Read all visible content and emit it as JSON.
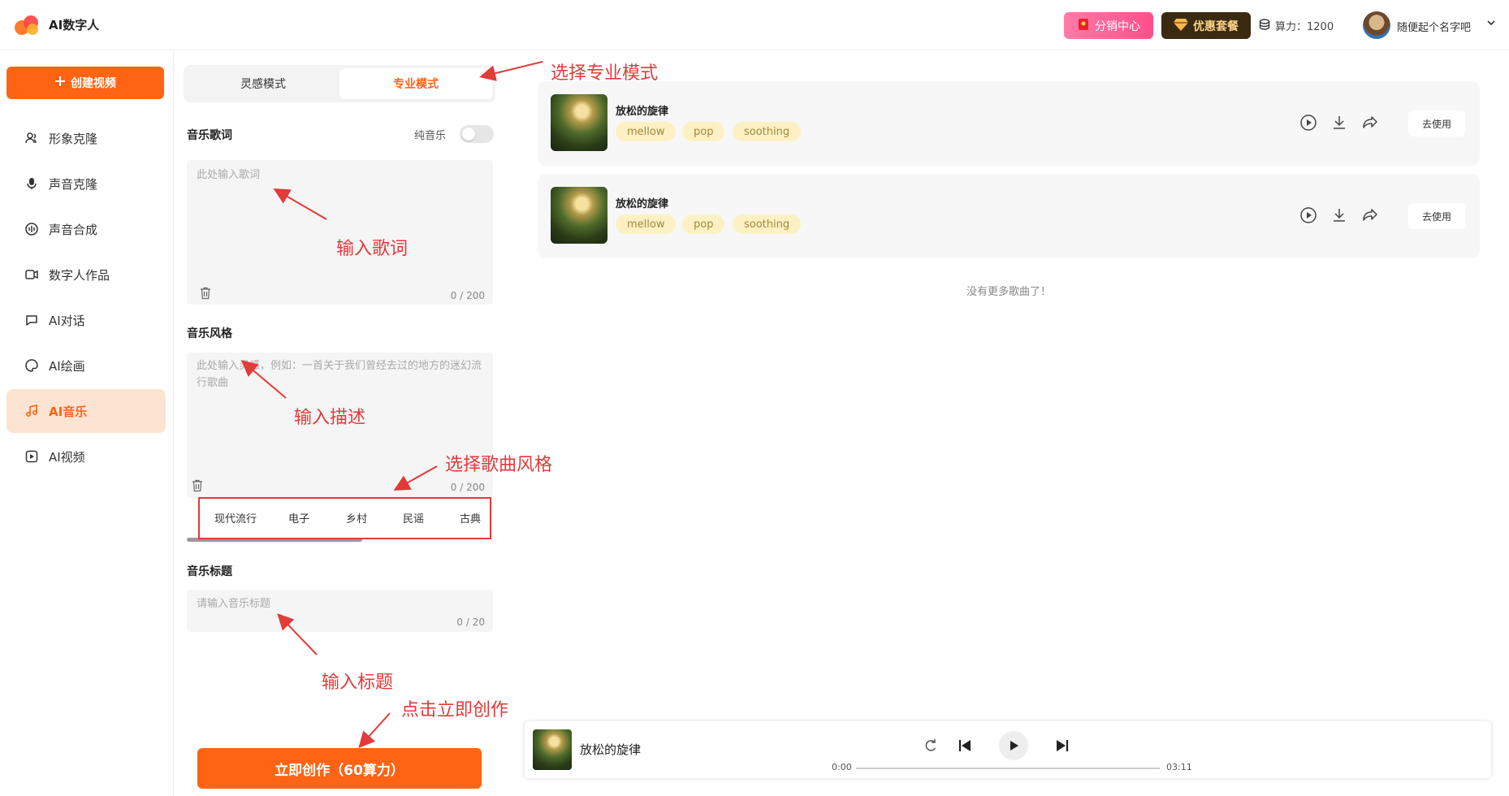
{
  "header": {
    "app_name": "AI数字人",
    "distribution_label": "分销中心",
    "package_label": "优惠套餐",
    "power_label": "算力：1200",
    "username": "随便起个名字吧"
  },
  "sidebar": {
    "create_label": "创建视频",
    "items": [
      {
        "label": "形象克隆",
        "icon": "user-clone-icon"
      },
      {
        "label": "声音克隆",
        "icon": "microphone-icon"
      },
      {
        "label": "声音合成",
        "icon": "waveform-icon"
      },
      {
        "label": "数字人作品",
        "icon": "video-camera-icon"
      },
      {
        "label": "AI对话",
        "icon": "chat-icon"
      },
      {
        "label": "AI绘画",
        "icon": "palette-icon"
      },
      {
        "label": "AI音乐",
        "icon": "music-note-icon"
      },
      {
        "label": "AI视频",
        "icon": "video-icon"
      }
    ],
    "active_index": 6
  },
  "form": {
    "tabs": [
      "灵感模式",
      "专业模式"
    ],
    "active_tab": 1,
    "lyrics_label": "音乐歌词",
    "instrumental_label": "纯音乐",
    "lyrics_placeholder": "此处输入歌词",
    "lyrics_counter": "0 / 200",
    "style_label": "音乐风格",
    "style_placeholder": "此处输入灵感，例如：一首关于我们曾经去过的地方的迷幻流行歌曲",
    "style_counter": "0 / 200",
    "style_chips": [
      "现代流行",
      "电子",
      "乡村",
      "民谣",
      "古典"
    ],
    "title_label": "音乐标题",
    "title_placeholder": "请输入音乐标题",
    "title_counter": "0 / 20",
    "submit_label": "立即创作（60算力）"
  },
  "annotations": {
    "select_mode": "选择专业模式",
    "input_lyrics": "输入歌词",
    "input_desc": "输入描述",
    "select_style": "选择歌曲风格",
    "input_title": "输入标题",
    "click_create": "点击立即创作"
  },
  "songs": [
    {
      "title": "放松的旋律",
      "tags": [
        "mellow",
        "pop",
        "soothing"
      ],
      "use_label": "去使用"
    },
    {
      "title": "放松的旋律",
      "tags": [
        "mellow",
        "pop",
        "soothing"
      ],
      "use_label": "去使用"
    }
  ],
  "no_more_text": "没有更多歌曲了！",
  "player": {
    "title": "放松的旋律",
    "current_time": "0:00",
    "duration": "03:11",
    "progress": 0
  },
  "colors": {
    "accent": "#ff6414",
    "annotation": "#e33a3a",
    "tag_bg": "#fdf1c4"
  }
}
